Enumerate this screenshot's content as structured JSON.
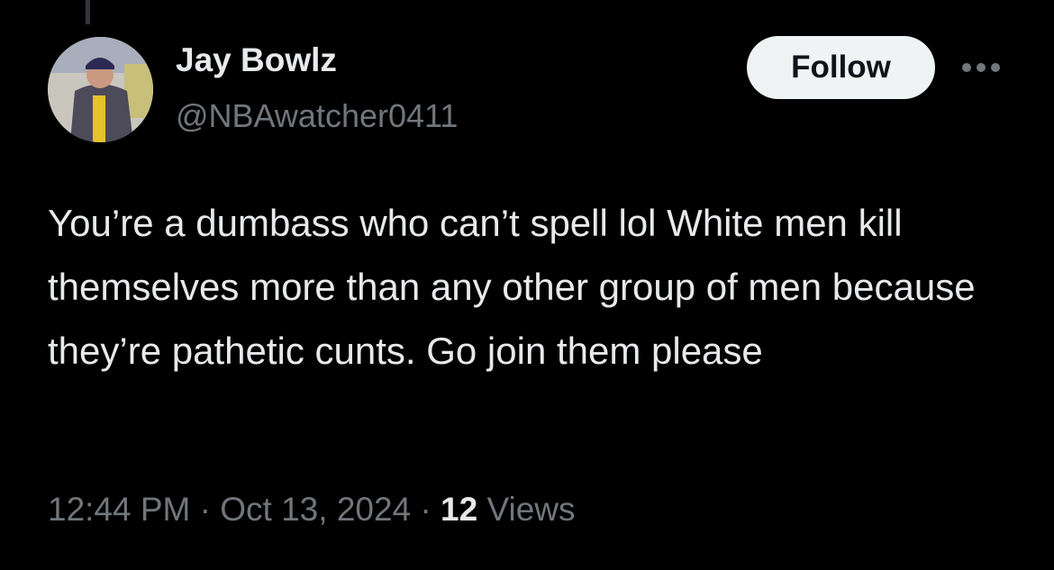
{
  "tweet": {
    "author_name": "Jay Bowlz",
    "author_handle": "@NBAwatcher0411",
    "follow_label": "Follow",
    "more_icon": "more-horizontal-icon",
    "text": "You’re a dumbass who can’t spell lol White men kill themselves more than any other group of men because they’re pathetic cunts. Go join them please",
    "time": "12:44 PM",
    "separator": " · ",
    "date": "Oct 13, 2024",
    "views_count": "12",
    "views_label": " Views"
  },
  "colors": {
    "background": "#000000",
    "text": "#e7e9ea",
    "secondary": "#71767b",
    "button": "#eff3f4"
  }
}
